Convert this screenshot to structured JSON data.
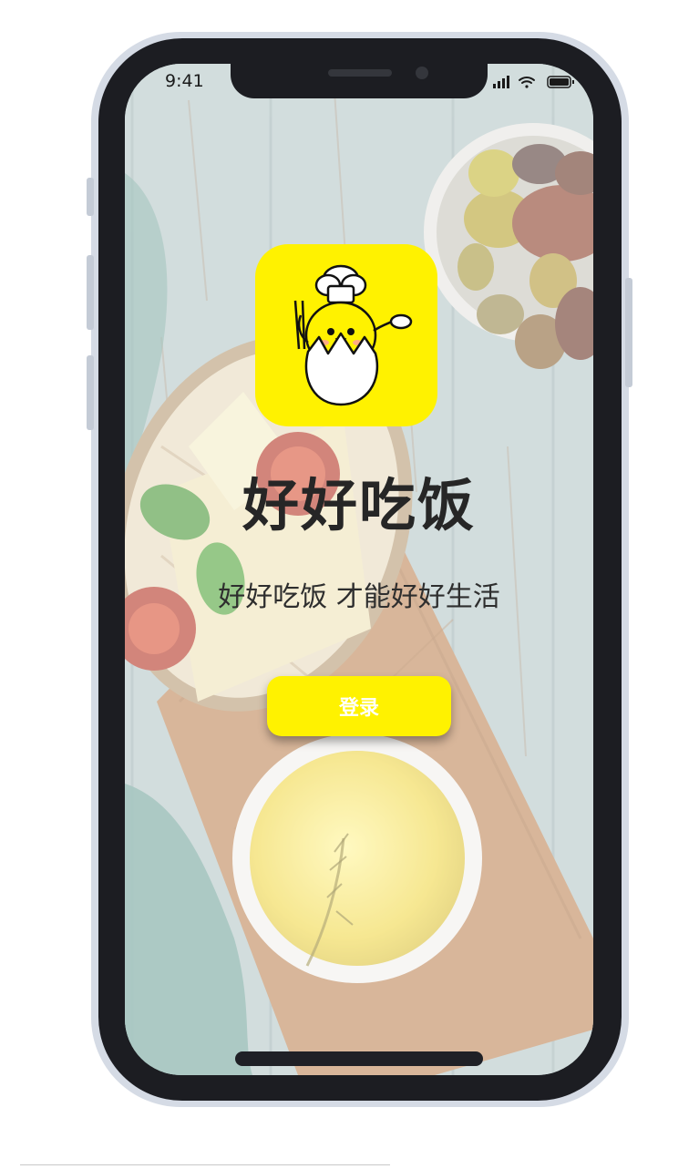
{
  "status_bar": {
    "time": "9:41"
  },
  "app": {
    "title": "好好吃饭",
    "tagline": "好好吃饭  才能好好生活",
    "login_label": "登录"
  },
  "colors": {
    "accent": "#fff200",
    "title_text": "#262626",
    "button_text": "#ffffff",
    "phone_frame": "#d5dbe5",
    "phone_body": "#1c1d22"
  },
  "icons": {
    "logo": "chick-chef-in-eggshell-icon",
    "signal": "cellular-signal-icon",
    "wifi": "wifi-icon",
    "battery": "battery-icon"
  }
}
